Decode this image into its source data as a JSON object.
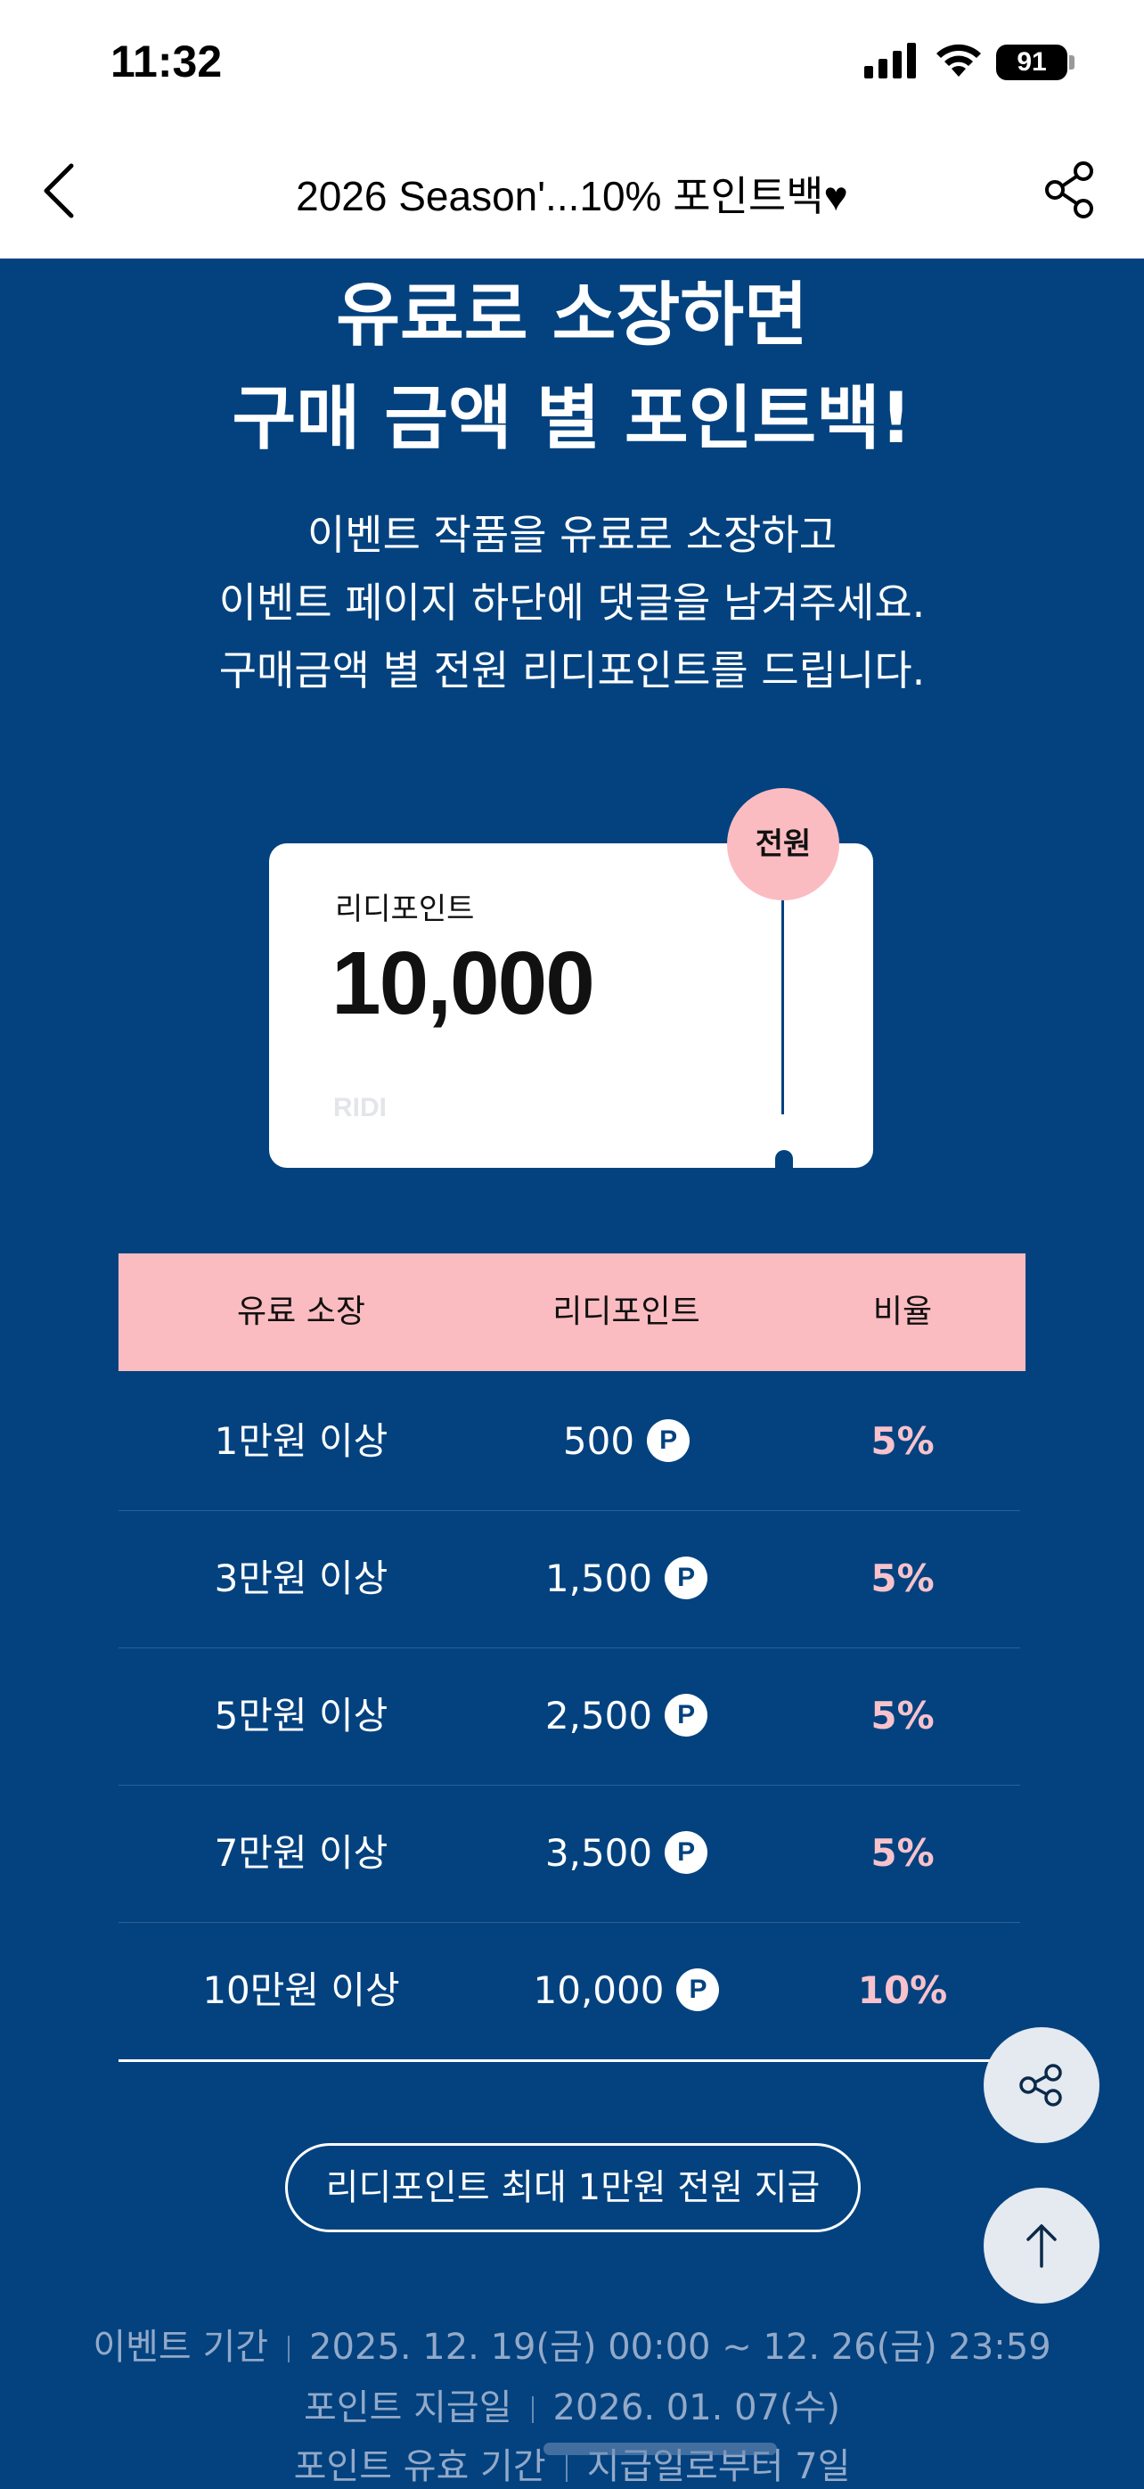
{
  "status_bar": {
    "time": "11:32",
    "battery": "91"
  },
  "nav": {
    "title": "2026 Season'...10% 포인트백♥"
  },
  "headline": {
    "line1": "유료로 소장하면",
    "line2": "구매 금액 별 포인트백!"
  },
  "description": {
    "line1": "이벤트 작품을 유료로 소장하고",
    "line2": "이벤트 페이지 하단에 댓글을 남겨주세요.",
    "line3": "구매금액 별 전원 리디포인트를 드립니다."
  },
  "ticket": {
    "label": "리디포인트",
    "value": "10,000",
    "brand": "RIDI",
    "badge": "전원"
  },
  "table": {
    "headers": [
      "유료 소장",
      "리디포인트",
      "비율"
    ],
    "point_icon": "P",
    "rows": [
      {
        "purchase": "1만원 이상",
        "points": "500",
        "rate": "5%"
      },
      {
        "purchase": "3만원 이상",
        "points": "1,500",
        "rate": "5%"
      },
      {
        "purchase": "5만원 이상",
        "points": "2,500",
        "rate": "5%"
      },
      {
        "purchase": "7만원 이상",
        "points": "3,500",
        "rate": "5%"
      },
      {
        "purchase": "10만원 이상",
        "points": "10,000",
        "rate": "10%"
      }
    ]
  },
  "pill_label": "리디포인트 최대 1만원 전원 지급",
  "info": {
    "period_label": "이벤트 기간",
    "period_value": "2025. 12. 19(금) 00:00 ~ 12. 26(금) 23:59",
    "payday_label": "포인트 지급일",
    "payday_value": "2026. 01. 07(수)",
    "validity_label": "포인트 유효 기간",
    "validity_value": "지급일로부터 7일"
  },
  "colors": {
    "background": "#03427f",
    "accent_pink": "#fbbcc1",
    "rate_pink": "#f7c2cc"
  }
}
